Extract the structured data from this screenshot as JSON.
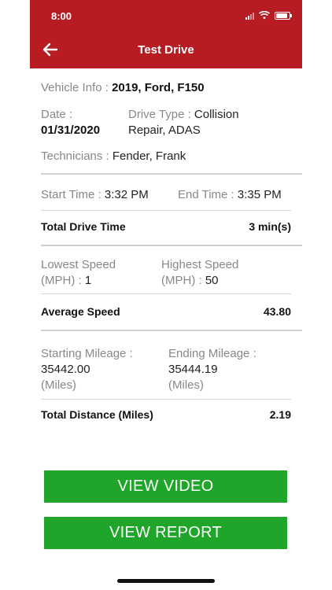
{
  "status": {
    "time": "8:00"
  },
  "header": {
    "title": "Test Drive"
  },
  "vehicle": {
    "label": "Vehicle Info : ",
    "value": "2019, Ford, F150"
  },
  "date": {
    "label": "Date :",
    "value": "01/31/2020"
  },
  "drive_type": {
    "label": "Drive Type : ",
    "value_line1": "Collision",
    "value_line2": "Repair, ADAS"
  },
  "technicians": {
    "label": "Technicians : ",
    "value": "Fender, Frank"
  },
  "time": {
    "start_label": "Start Time : ",
    "start_value": "3:32 PM",
    "end_label": "End Time : ",
    "end_value": "3:35 PM",
    "total_label": "Total Drive Time",
    "total_value": "3 min(s)"
  },
  "speed": {
    "lowest_label_line1": "Lowest Speed",
    "lowest_label_line2": "(MPH) : ",
    "lowest_value": "1",
    "highest_label_line1": "Highest Speed",
    "highest_label_line2": "(MPH) : ",
    "highest_value": "50",
    "average_label": "Average Speed",
    "average_value": "43.80"
  },
  "mileage": {
    "start_label": "Starting Mileage :",
    "start_value": "35442.00",
    "start_unit": "(Miles)",
    "end_label": "Ending Mileage :",
    "end_value": "35444.19",
    "end_unit": "(Miles)",
    "distance_label": "Total Distance (Miles)",
    "distance_value": "2.19"
  },
  "buttons": {
    "view_video": "VIEW VIDEO",
    "view_report": "VIEW REPORT"
  },
  "colors": {
    "header_bg": "#b71c23",
    "button_bg": "#1fa52a"
  },
  "icons": {
    "back": "arrow-left-icon",
    "signal": "signal-icon",
    "wifi": "wifi-icon",
    "battery": "battery-icon"
  }
}
